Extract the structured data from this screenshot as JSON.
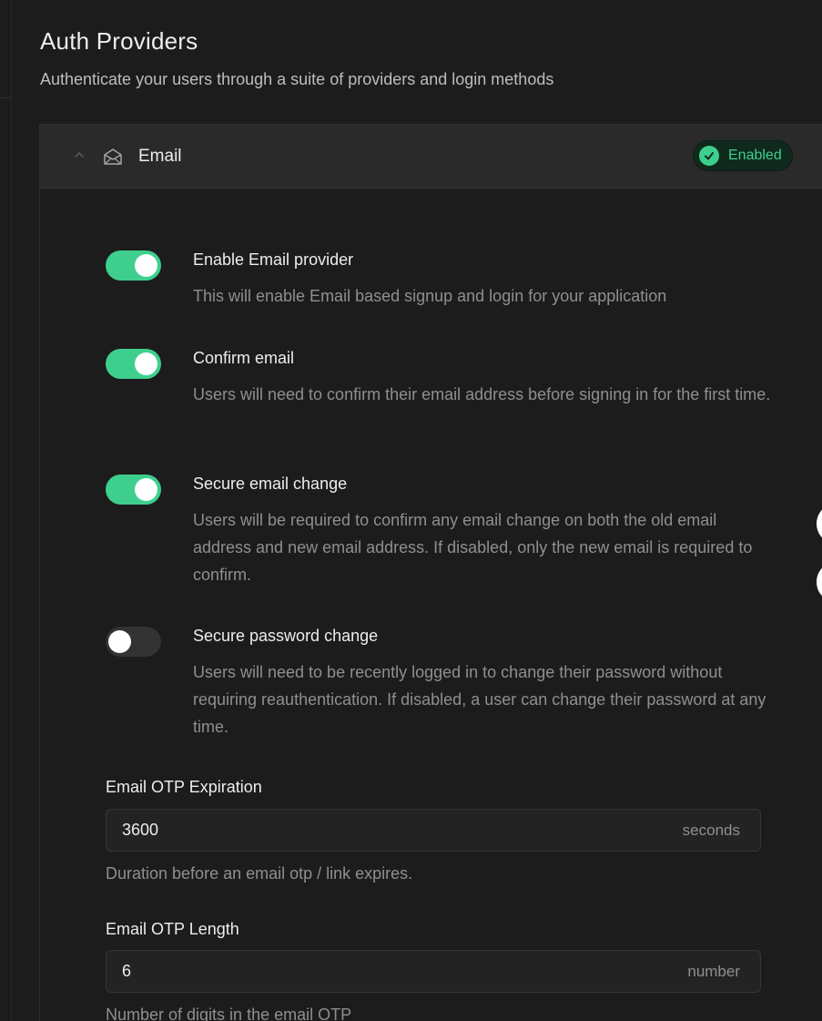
{
  "header": {
    "title": "Auth Providers",
    "subtitle": "Authenticate your users through a suite of providers and login methods"
  },
  "provider": {
    "name": "Email",
    "icon": "mail-open-icon",
    "status_label": "Enabled",
    "status_color": "#3ecf8e"
  },
  "settings": [
    {
      "title": "Enable Email provider",
      "description": "This will enable Email based signup and login for your application",
      "enabled": true
    },
    {
      "title": "Confirm email",
      "description": "Users will need to confirm their email address before signing in for the first time.",
      "enabled": true
    },
    {
      "title": "Secure email change",
      "description": "Users will be required to confirm any email change on both the old email address and new email address. If disabled, only the new email is required to confirm.",
      "enabled": true
    },
    {
      "title": "Secure password change",
      "description": "Users will need to be recently logged in to change their password without requiring reauthentication. If disabled, a user can change their password at any time.",
      "enabled": false
    }
  ],
  "fields": {
    "otp_expiration": {
      "label": "Email OTP Expiration",
      "value": "3600",
      "unit": "seconds",
      "help": "Duration before an email otp / link expires."
    },
    "otp_length": {
      "label": "Email OTP Length",
      "value": "6",
      "unit": "number",
      "help": "Number of digits in the email OTP"
    }
  },
  "colors": {
    "accent": "#3ecf8e",
    "background": "#1c1c1c",
    "header_background": "#2a2a2a"
  }
}
